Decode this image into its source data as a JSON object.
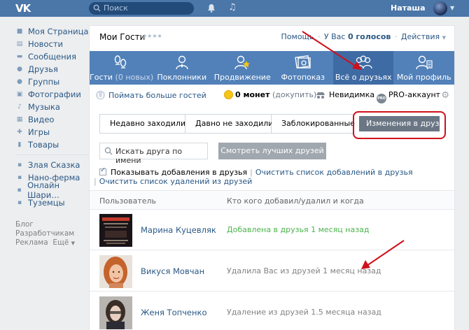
{
  "topbar": {
    "logo": "VK",
    "search_placeholder": "Поиск",
    "user_name": "Наташа"
  },
  "sidebar": {
    "items": [
      {
        "label": "Моя Страница",
        "icon": "home-icon"
      },
      {
        "label": "Новости",
        "icon": "news-icon"
      },
      {
        "label": "Сообщения",
        "icon": "messages-icon"
      },
      {
        "label": "Друзья",
        "icon": "friends-icon"
      },
      {
        "label": "Группы",
        "icon": "groups-icon"
      },
      {
        "label": "Фотографии",
        "icon": "photos-icon"
      },
      {
        "label": "Музыка",
        "icon": "music-icon"
      },
      {
        "label": "Видео",
        "icon": "video-icon"
      },
      {
        "label": "Игры",
        "icon": "games-icon"
      },
      {
        "label": "Товары",
        "icon": "goods-icon"
      }
    ],
    "apps": [
      {
        "label": "Злая Сказка",
        "icon": "app-icon"
      },
      {
        "label": "Нано-ферма",
        "icon": "app-icon"
      },
      {
        "label": "Онлайн Шари…",
        "icon": "app-icon"
      },
      {
        "label": "Туземцы",
        "icon": "app-icon"
      }
    ],
    "footer": {
      "blog": "Блог",
      "dev": "Разработчикам",
      "ads": "Реклама",
      "more": "Ещё"
    }
  },
  "header": {
    "title": "Мои Гости",
    "stars": "★★★★",
    "help": "Помощь",
    "votes_prefix": "У Вас",
    "votes": "0 голосов",
    "actions": "Действия"
  },
  "tabs": [
    {
      "label": "Гости",
      "sub": "(0 новых)",
      "icon": "guests-icon"
    },
    {
      "label": "Поклонники",
      "sub": "",
      "icon": "fans-icon"
    },
    {
      "label": "Продвижение",
      "sub": "",
      "icon": "promotion-icon"
    },
    {
      "label": "Фотопоказ",
      "sub": "",
      "icon": "photoshow-icon"
    },
    {
      "label": "Всё о друзьях",
      "sub": "",
      "icon": "friends-all-icon"
    },
    {
      "label": "Мой профиль",
      "sub": "",
      "icon": "profile-icon"
    }
  ],
  "active_tab": 4,
  "toolbar": {
    "catch": "Поймать больше гостей",
    "coins": "0 монет",
    "buy": "(докупить)",
    "invisible": "Невидимка",
    "pro": "PRO-аккаунт",
    "pro_badge": "PRO"
  },
  "filters": [
    "Недавно заходили",
    "Давно не заходили",
    "Заблокированные",
    "Изменения в друзьях"
  ],
  "active_filter": 3,
  "search": {
    "placeholder": "Искать друга по имени",
    "best_button": "Смотреть лучших друзей"
  },
  "options": {
    "show_additions": "Показывать добавления в друзья",
    "clear_additions": "Очистить список добавлений в друзья",
    "clear_removals": "Очистить список удалений из друзей"
  },
  "table": {
    "col_user": "Пользователь",
    "col_action": "Кто кого добавил/удалил и когда",
    "rows": [
      {
        "name": "Марина Куцевляк",
        "action": "Добавлена в друзья 1 месяц назад",
        "status": "added"
      },
      {
        "name": "Викуся Мовчан",
        "action": "Удалила Вас из друзей 1 месяц назад",
        "status": "removed"
      },
      {
        "name": "Женя Топченко",
        "action": "Удаление из друзей 1.5 месяца назад",
        "status": "removed"
      }
    ]
  },
  "colors": {
    "topbar": "#4a76a8",
    "tabs": "#5281b9",
    "link": "#2a5885",
    "added": "#4bb34b",
    "highlight": "#d0101b"
  }
}
